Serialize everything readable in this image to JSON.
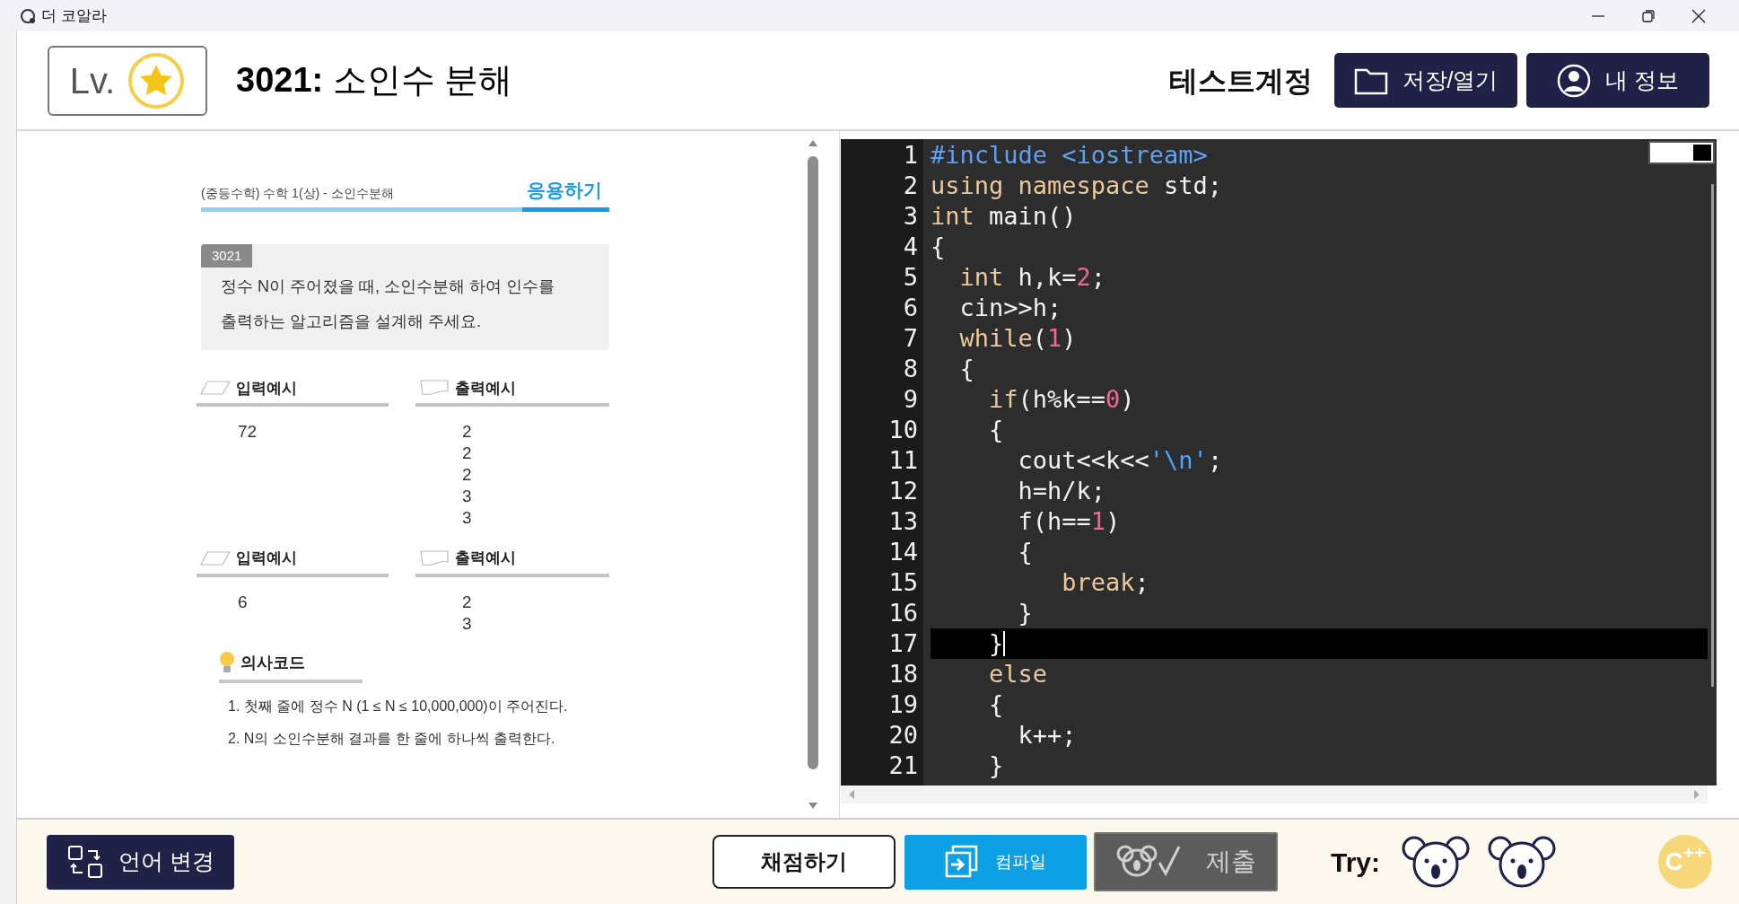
{
  "window": {
    "title": "더 코알라"
  },
  "header": {
    "level_label": "Lv.",
    "title": "**3021:** 소인수 분해",
    "account": "테스트계정",
    "buttons": [
      {
        "label": "저장/열기",
        "kind": "folder"
      },
      {
        "label": "내 정보",
        "kind": "user"
      }
    ]
  },
  "problem": {
    "breadcrumb": "(중등수학) 수학 1(상) - 소인수분해",
    "category": "응용하기",
    "number": "3021",
    "statement": [
      "정수 N이 주어졌을 때, 소인수분해 하여 인수를",
      "출력하는 알고리즘을 설계해 주세요."
    ],
    "examples": [
      {
        "input_label": "입력예시",
        "output_label": "출력예시",
        "input": [
          "72"
        ],
        "output": [
          "2",
          "2",
          "2",
          "3",
          "3"
        ]
      },
      {
        "input_label": "입력예시",
        "output_label": "출력예시",
        "input": [
          "6"
        ],
        "output": [
          "2",
          "3"
        ]
      }
    ],
    "pseudocode_label": "의사코드",
    "pseudocode": [
      "1. 첫째 줄에 정수 N (1 ≤ N ≤ 10,000,000)이 주어진다.",
      "2. N의 소인수분해 결과를 한 줄에 하나씩 출력한다."
    ]
  },
  "editor": {
    "toggle": {
      "on": true
    },
    "lines": [
      {
        "number": "1",
        "current": false,
        "tokens": [
          {
            "text": "#include <iostream>",
            "kind": "preprocessor"
          }
        ]
      },
      {
        "number": "2",
        "current": false,
        "tokens": [
          {
            "text": "using namespace",
            "kind": "keyword"
          },
          {
            "text": " std;",
            "kind": "plain"
          }
        ]
      },
      {
        "number": "3",
        "current": false,
        "tokens": [
          {
            "text": "int",
            "kind": "keyword"
          },
          {
            "text": " main()",
            "kind": "plain"
          }
        ]
      },
      {
        "number": "4",
        "current": false,
        "tokens": [
          {
            "text": "{",
            "kind": "plain"
          }
        ]
      },
      {
        "number": "5",
        "current": false,
        "tokens": [
          {
            "text": "  int",
            "kind": "keyword"
          },
          {
            "text": " h,k=",
            "kind": "plain"
          },
          {
            "text": "2",
            "kind": "number"
          },
          {
            "text": ";",
            "kind": "plain"
          }
        ]
      },
      {
        "number": "6",
        "current": false,
        "tokens": [
          {
            "text": "  cin>>h;",
            "kind": "plain"
          }
        ]
      },
      {
        "number": "7",
        "current": false,
        "tokens": [
          {
            "text": "  while",
            "kind": "keyword"
          },
          {
            "text": "(",
            "kind": "plain"
          },
          {
            "text": "1",
            "kind": "number"
          },
          {
            "text": ")",
            "kind": "plain"
          }
        ]
      },
      {
        "number": "8",
        "current": false,
        "tokens": [
          {
            "text": "  {",
            "kind": "plain"
          }
        ]
      },
      {
        "number": "9",
        "current": false,
        "tokens": [
          {
            "text": "    if",
            "kind": "keyword"
          },
          {
            "text": "(h%k==",
            "kind": "plain"
          },
          {
            "text": "0",
            "kind": "number"
          },
          {
            "text": ")",
            "kind": "plain"
          }
        ]
      },
      {
        "number": "10",
        "current": false,
        "tokens": [
          {
            "text": "    {",
            "kind": "plain"
          }
        ]
      },
      {
        "number": "11",
        "current": false,
        "tokens": [
          {
            "text": "      cout<<k<<",
            "kind": "plain"
          },
          {
            "text": "'\\n'",
            "kind": "string"
          },
          {
            "text": ";",
            "kind": "plain"
          }
        ]
      },
      {
        "number": "12",
        "current": false,
        "tokens": [
          {
            "text": "      h=h/k;",
            "kind": "plain"
          }
        ]
      },
      {
        "number": "13",
        "current": false,
        "tokens": [
          {
            "text": "      f(h==",
            "kind": "plain"
          },
          {
            "text": "1",
            "kind": "number"
          },
          {
            "text": ")",
            "kind": "plain"
          }
        ]
      },
      {
        "number": "14",
        "current": false,
        "tokens": [
          {
            "text": "      {",
            "kind": "plain"
          }
        ]
      },
      {
        "number": "15",
        "current": false,
        "tokens": [
          {
            "text": "         break",
            "kind": "keyword"
          },
          {
            "text": ";",
            "kind": "plain"
          }
        ]
      },
      {
        "number": "16",
        "current": false,
        "tokens": [
          {
            "text": "      }",
            "kind": "plain"
          }
        ]
      },
      {
        "number": "17",
        "current": true,
        "tokens": [
          {
            "text": "    }",
            "kind": "plain"
          }
        ]
      },
      {
        "number": "18",
        "current": false,
        "tokens": [
          {
            "text": "    else",
            "kind": "keyword"
          }
        ]
      },
      {
        "number": "19",
        "current": false,
        "tokens": [
          {
            "text": "    {",
            "kind": "plain"
          }
        ]
      },
      {
        "number": "20",
        "current": false,
        "tokens": [
          {
            "text": "      k++;",
            "kind": "plain"
          }
        ]
      },
      {
        "number": "21",
        "current": false,
        "tokens": [
          {
            "text": "    }",
            "kind": "plain"
          }
        ]
      }
    ]
  },
  "footer": {
    "language_button": "언어 변경",
    "grade_button": "채점하기",
    "compile_button": "컴파일",
    "submit_button": {
      "label": "제출",
      "disabled": true
    },
    "try_label": "Try:",
    "tries": [
      {
        "kind": "koala"
      },
      {
        "kind": "koala"
      }
    ],
    "language_badge": "C$^{++}$"
  }
}
